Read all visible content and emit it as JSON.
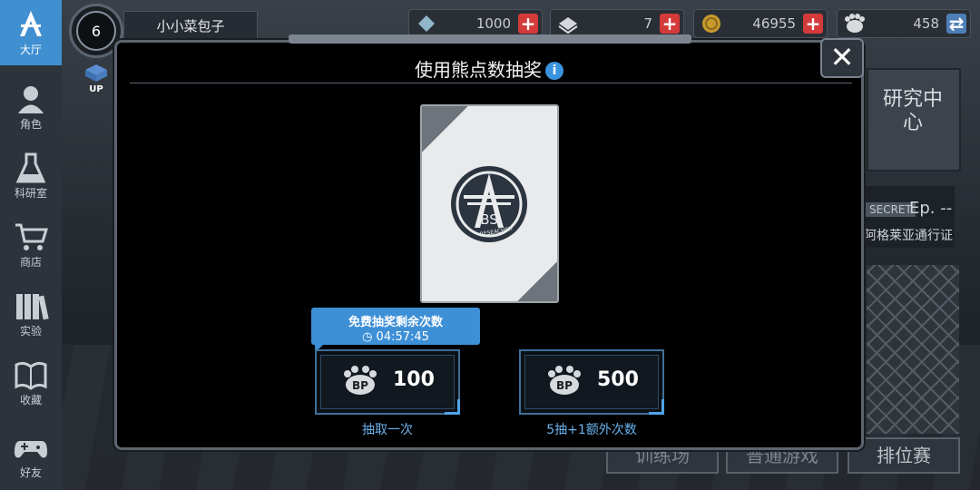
{
  "sidebar": {
    "items": [
      {
        "label": "大厅",
        "icon": "lobby-star-icon"
      },
      {
        "label": "角色",
        "icon": "character-icon"
      },
      {
        "label": "科研室",
        "icon": "flask-icon"
      },
      {
        "label": "商店",
        "icon": "cart-icon"
      },
      {
        "label": "实验",
        "icon": "books-icon"
      },
      {
        "label": "收藏",
        "icon": "open-book-icon"
      },
      {
        "label": "好友",
        "icon": "gamepad-icon"
      }
    ]
  },
  "player": {
    "level": "6",
    "name": "小小菜包子",
    "up_badge": "UP"
  },
  "resources": [
    {
      "icon": "crystal-icon",
      "value": "1000"
    },
    {
      "icon": "ticket-icon",
      "value": "7"
    },
    {
      "icon": "coin-icon",
      "value": "46955"
    },
    {
      "icon": "bp-paw-icon",
      "value": "458"
    }
  ],
  "background": {
    "research_center": "研究中心",
    "secret_tag": "SECRET",
    "episode": "Ep. --",
    "pass_label": "阿格莱亚通行证",
    "buttons": [
      "训练场",
      "普通游戏",
      "排位赛"
    ]
  },
  "modal": {
    "title": "使用熊点数抽奖",
    "info_icon": "i",
    "close_icon": "✕",
    "card": {
      "logo_text": "BS",
      "logo_sub": "RESEACHER"
    },
    "tooltip": {
      "line1": "免费抽奖剩余次数",
      "timer": "04:57:45"
    },
    "options": [
      {
        "cost": "100",
        "caption": "抽取一次"
      },
      {
        "cost": "500",
        "caption": "5抽+1额外次数"
      }
    ]
  },
  "colors": {
    "accent": "#3d8fd6",
    "plus_red": "#d43a3a",
    "caption_blue": "#6ab3ef"
  }
}
